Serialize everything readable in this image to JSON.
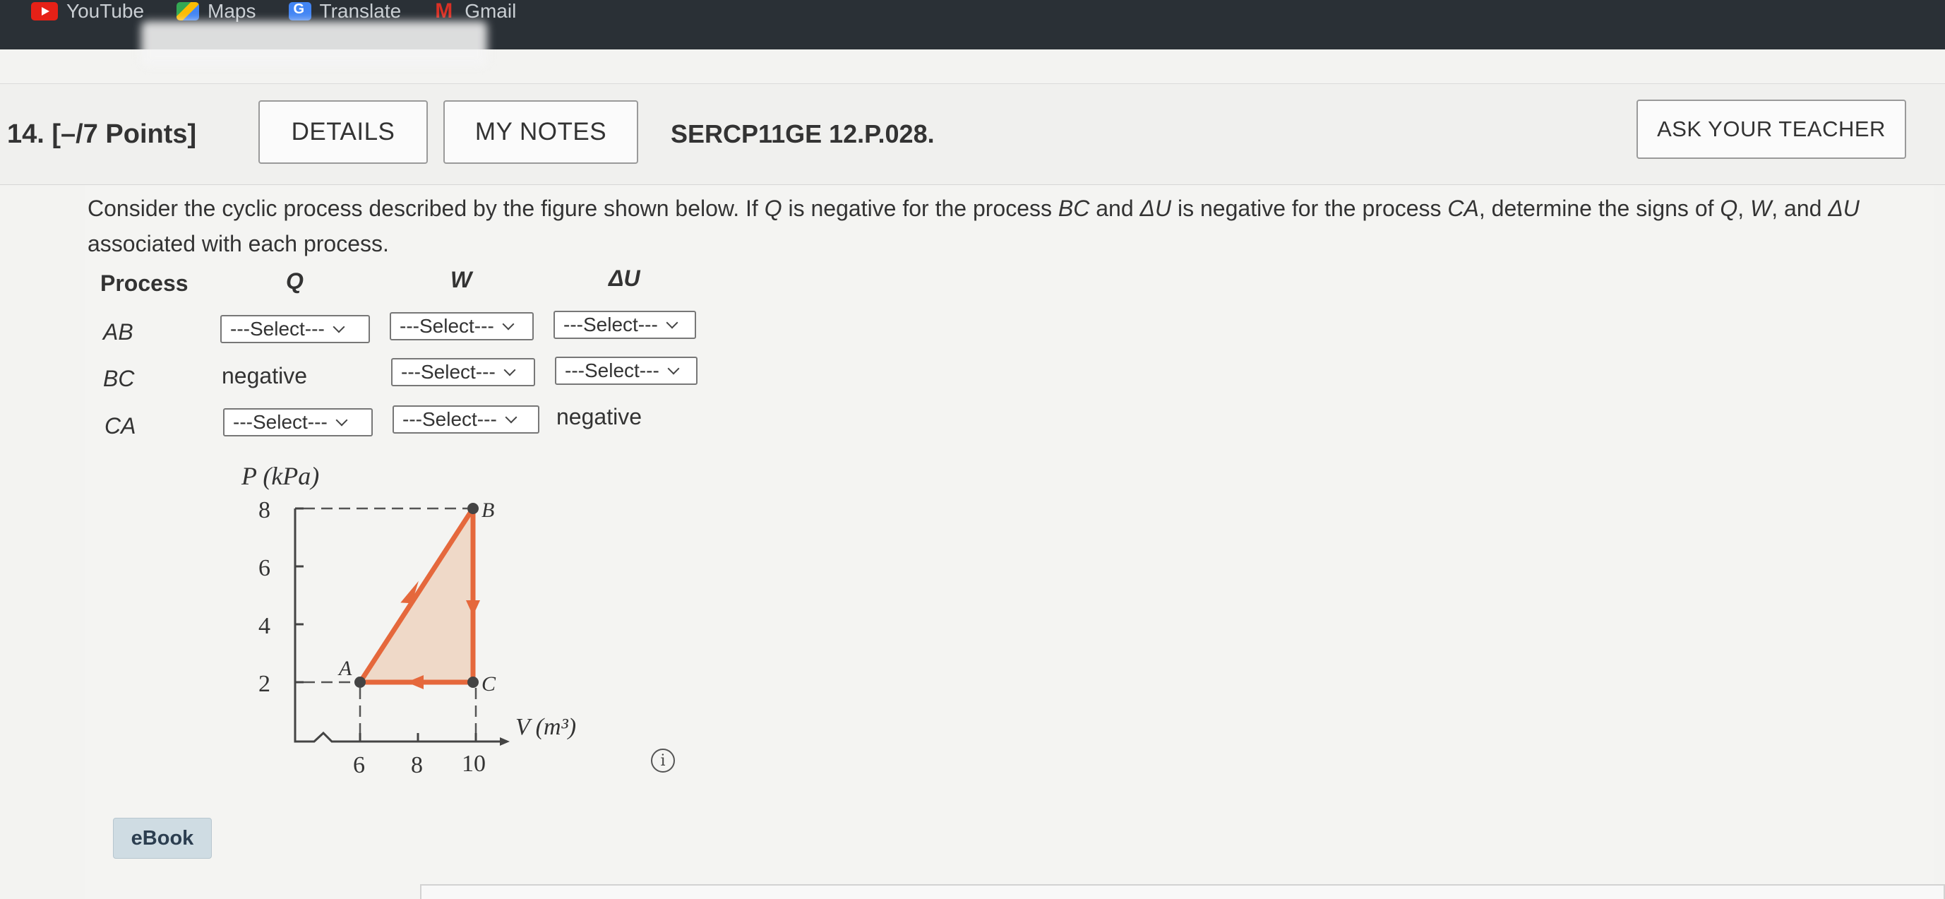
{
  "bookmarks": [
    {
      "label": "YouTube",
      "icon": "youtube-icon"
    },
    {
      "label": "Maps",
      "icon": "maps-icon"
    },
    {
      "label": "Translate",
      "icon": "translate-icon"
    },
    {
      "label": "Gmail",
      "icon": "gmail-icon"
    }
  ],
  "header": {
    "question_number": "14.",
    "points": "[–/7 Points]",
    "details_label": "DETAILS",
    "notes_label": "MY NOTES",
    "problem_code": "SERCP11GE 12.P.028.",
    "ask_teacher_label": "ASK YOUR TEACHER"
  },
  "prompt": {
    "part1": "Consider the cyclic process described by the figure shown below. If ",
    "var_q": "Q",
    "part2": " is negative for the process ",
    "var_bc": "BC",
    "part3": " and ",
    "var_du": "ΔU",
    "part4": " is negative for the process ",
    "var_ca": "CA",
    "part5": ", determine the signs of ",
    "var_q2": "Q",
    "sep1": ", ",
    "var_w": "W",
    "part6": ", and ",
    "var_du2": "ΔU",
    "part7": " associated with each process."
  },
  "table": {
    "headers": {
      "process": "Process",
      "q": "Q",
      "w": "W",
      "du": "ΔU"
    },
    "select_placeholder": "---Select---",
    "rows": [
      {
        "process": "AB"
      },
      {
        "process": "BC",
        "q": "negative"
      },
      {
        "process": "CA",
        "du": "negative"
      }
    ]
  },
  "figure": {
    "y_axis_label": "P (kPa)",
    "x_axis_label": "V (m³)",
    "y_ticks": [
      "8",
      "6",
      "4",
      "2"
    ],
    "x_ticks": [
      "6",
      "8",
      "10"
    ],
    "point_labels": [
      "A",
      "B",
      "C"
    ],
    "colors": {
      "path": "#e5683c",
      "fill": "#efd9c8",
      "points": "#444444"
    }
  },
  "info_symbol": "i",
  "ebook_label": "eBook"
}
